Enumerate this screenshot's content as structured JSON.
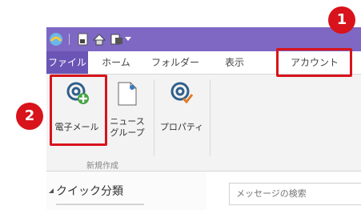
{
  "ribbon_tabs": [
    {
      "label": "ファイル"
    },
    {
      "label": "ホーム"
    },
    {
      "label": "フォルダー"
    },
    {
      "label": "表示"
    },
    {
      "label": "アカウント"
    }
  ],
  "commands": {
    "email": {
      "label": "電子メール"
    },
    "newsgroup": {
      "label_line1": "ニュース",
      "label_line2": "グループ"
    },
    "properties": {
      "label": "プロパティ"
    }
  },
  "group_new_label": "新規作成",
  "nav": {
    "quick_views": "クイック分類"
  },
  "search": {
    "placeholder": "メッセージの検索"
  },
  "annotations": {
    "step1": "1",
    "step2": "2"
  },
  "colors": {
    "accent": "#7e68c4",
    "file_tab": "#6a54b5",
    "highlight": "#d8131b"
  }
}
